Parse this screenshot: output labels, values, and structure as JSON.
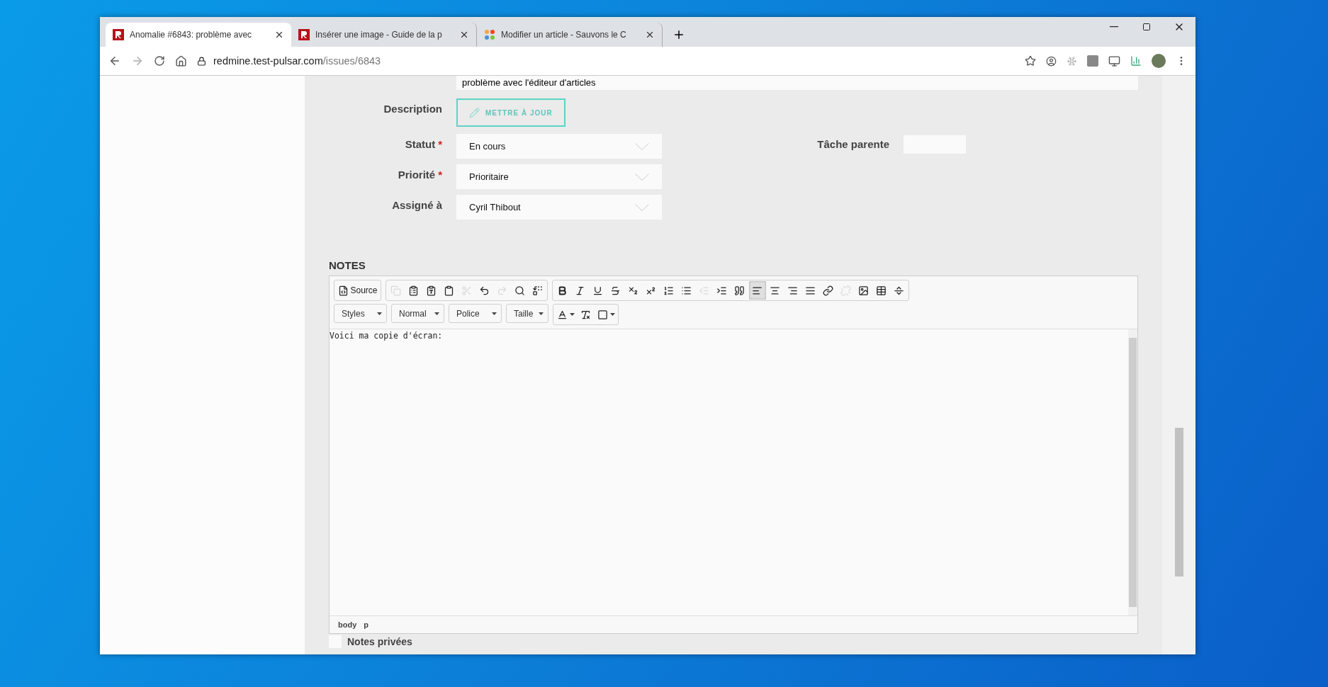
{
  "tabs": [
    {
      "title": "Anomalie #6843: problème avec",
      "selected": true,
      "kind": "redmine"
    },
    {
      "title": "Insérer une image - Guide de la p",
      "selected": false,
      "kind": "redmine"
    },
    {
      "title": "Modifier un article - Sauvons le C",
      "selected": false,
      "kind": "joomla"
    }
  ],
  "address": {
    "host": "redmine.test-pulsar.com",
    "path": "/issues/6843"
  },
  "subject": {
    "value": "problème avec l'éditeur d'articles"
  },
  "description": {
    "label": "Description",
    "button": "METTRE À JOUR"
  },
  "fields": [
    {
      "label": "Statut",
      "required_mark": "*",
      "value": "En cours"
    },
    {
      "label": "Priorité",
      "required_mark": "*",
      "value": "Prioritaire"
    },
    {
      "label": "Assigné à",
      "value": "Cyril Thibout"
    }
  ],
  "parent_task": {
    "label": "Tâche parente"
  },
  "notes": {
    "heading": "NOTES",
    "toolbar_row_1": [
      [
        {
          "kind": "source",
          "label": "Source",
          "disabled": false,
          "selected": false
        }
      ],
      [
        {
          "kind": "copy",
          "disabled": true,
          "selected": false
        },
        {
          "kind": "paste-word",
          "disabled": false,
          "selected": false
        },
        {
          "kind": "paste-text",
          "disabled": false,
          "selected": false
        },
        {
          "kind": "paste",
          "disabled": false,
          "selected": false
        },
        {
          "kind": "cut",
          "disabled": true,
          "selected": false
        },
        {
          "kind": "undo",
          "disabled": false,
          "selected": false
        },
        {
          "kind": "redo",
          "disabled": true,
          "selected": false
        },
        {
          "kind": "find",
          "disabled": false,
          "selected": false
        },
        {
          "kind": "replace",
          "disabled": false,
          "selected": false
        }
      ],
      [
        {
          "kind": "bold",
          "disabled": false,
          "selected": false
        },
        {
          "kind": "italic",
          "disabled": false,
          "selected": false
        },
        {
          "kind": "underline",
          "disabled": false,
          "selected": false
        },
        {
          "kind": "strike",
          "disabled": false,
          "selected": false
        },
        {
          "kind": "subscript",
          "disabled": false,
          "selected": false
        },
        {
          "kind": "superscript",
          "disabled": false,
          "selected": false
        },
        {
          "kind": "ordered-list",
          "disabled": false,
          "selected": false
        },
        {
          "kind": "bullet-list",
          "disabled": false,
          "selected": false
        },
        {
          "kind": "outdent",
          "disabled": true,
          "selected": false
        },
        {
          "kind": "indent",
          "disabled": false,
          "selected": false
        },
        {
          "kind": "quote",
          "disabled": false,
          "selected": false
        },
        {
          "kind": "align-left",
          "disabled": false,
          "selected": true
        },
        {
          "kind": "align-center",
          "disabled": false,
          "selected": false
        },
        {
          "kind": "align-right",
          "disabled": false,
          "selected": false
        },
        {
          "kind": "justify",
          "disabled": false,
          "selected": false
        },
        {
          "kind": "link",
          "disabled": false,
          "selected": false
        },
        {
          "kind": "unlink",
          "disabled": true,
          "selected": false
        },
        {
          "kind": "image",
          "disabled": false,
          "selected": false
        },
        {
          "kind": "table",
          "disabled": false,
          "selected": false
        },
        {
          "kind": "rule",
          "disabled": false,
          "selected": false
        }
      ]
    ],
    "dropdowns": [
      "Styles",
      "Normal",
      "Police",
      "Taille"
    ],
    "color_tools": [
      {
        "kind": "text-color"
      },
      {
        "kind": "remove-format"
      },
      {
        "kind": "bg-color"
      }
    ],
    "content": "Voici ma copie d'écran:",
    "path": [
      "body",
      "p"
    ]
  },
  "private_notes": {
    "label": "Notes privées",
    "checked": false
  }
}
